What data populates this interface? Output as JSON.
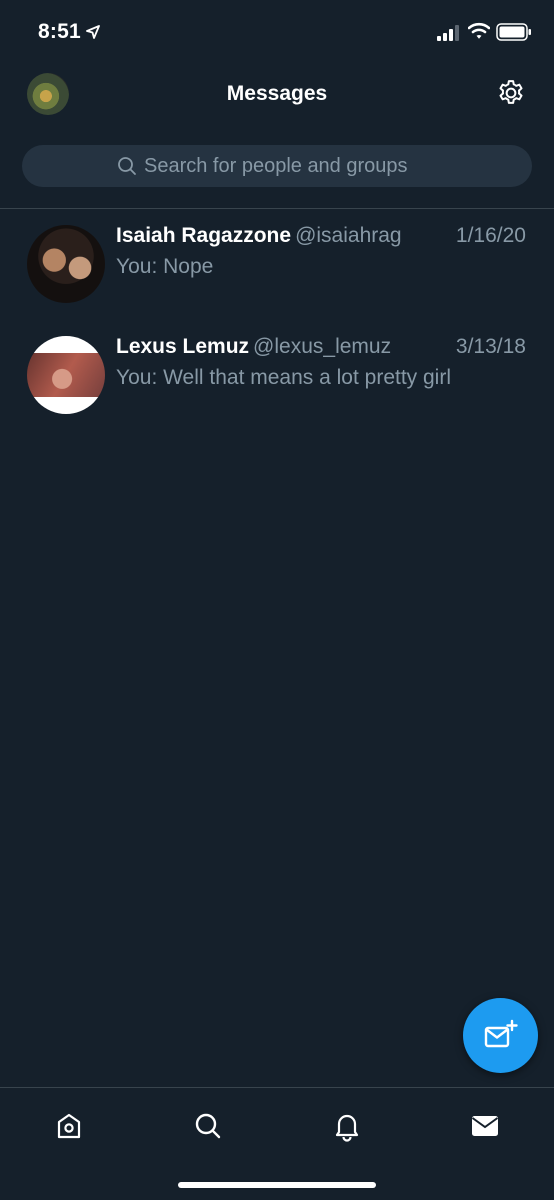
{
  "status_bar": {
    "time": "8:51"
  },
  "header": {
    "title": "Messages"
  },
  "search": {
    "placeholder": "Search for people and groups"
  },
  "conversations": [
    {
      "name": "Isaiah Ragazzone",
      "handle": "@isaiahrag",
      "date": "1/16/20",
      "last_message": "You: Nope"
    },
    {
      "name": "Lexus Lemuz",
      "handle": "@lexus_lemuz",
      "date": "3/13/18",
      "last_message": "You: Well that means a lot pretty girl"
    }
  ],
  "colors": {
    "background": "#15202b",
    "accent": "#1d9bf0",
    "secondary_text": "#8899a6",
    "search_bg": "#253341"
  },
  "icons": {
    "settings": "gear-icon",
    "search": "search-icon",
    "compose": "new-message-icon",
    "nav": [
      "home-icon",
      "search-icon",
      "bell-icon",
      "mail-icon"
    ]
  }
}
